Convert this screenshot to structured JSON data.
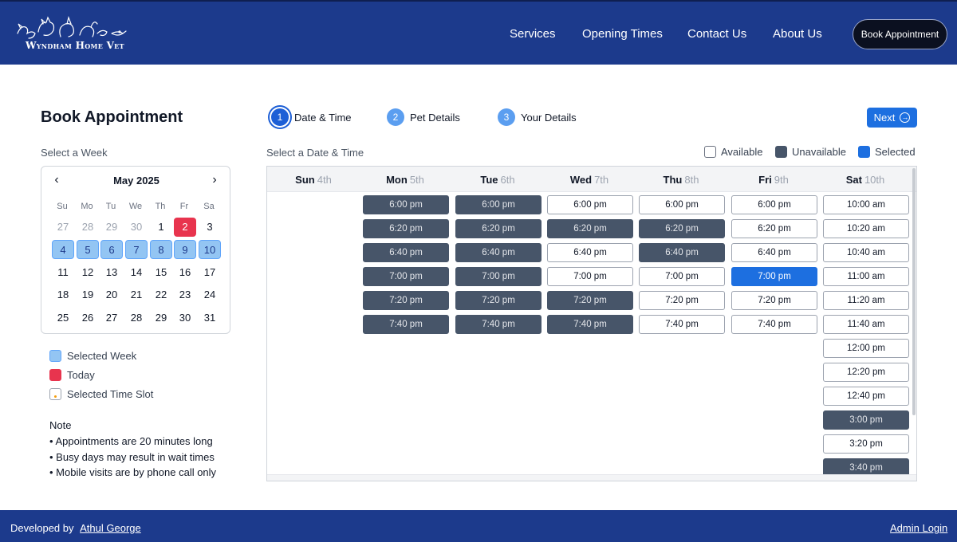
{
  "brand": {
    "name": "Wyndham Home Vet",
    "logo_icon": "pets-line-art-logo"
  },
  "nav": {
    "items": [
      "Services",
      "Opening Times",
      "Contact Us",
      "About Us"
    ],
    "book_label": "Book Appointment"
  },
  "page": {
    "title": "Book Appointment",
    "select_week_label": "Select a Week",
    "select_datetime_label": "Select a Date & Time"
  },
  "calendar": {
    "month": "May 2025",
    "weekdays": [
      "Su",
      "Mo",
      "Tu",
      "We",
      "Th",
      "Fr",
      "Sa"
    ],
    "weeks": [
      [
        "27",
        "28",
        "29",
        "30",
        "1",
        "2",
        "3"
      ],
      [
        "4",
        "5",
        "6",
        "7",
        "8",
        "9",
        "10"
      ],
      [
        "11",
        "12",
        "13",
        "14",
        "15",
        "16",
        "17"
      ],
      [
        "18",
        "19",
        "20",
        "21",
        "22",
        "23",
        "24"
      ],
      [
        "25",
        "26",
        "27",
        "28",
        "29",
        "30",
        "31"
      ]
    ],
    "muted": [
      [
        0,
        0
      ],
      [
        0,
        1
      ],
      [
        0,
        2
      ],
      [
        0,
        3
      ]
    ],
    "today": [
      0,
      5
    ],
    "selected_week_row": 1
  },
  "legend": [
    {
      "label": "Selected Week",
      "color": "#93c5f3",
      "border": "#60a5fa"
    },
    {
      "label": "Today",
      "color": "#e8344e",
      "border": "#e8344e"
    },
    {
      "label": "Selected Time Slot",
      "color": "#ffffff",
      "border": "#9ca3af"
    }
  ],
  "note": {
    "title": "Note",
    "items": [
      "Appointments are 20 minutes long",
      "Busy days may result in wait times",
      "Mobile visits are by phone call only"
    ]
  },
  "steps": [
    {
      "num": "1",
      "label": "Date & Time",
      "active": true
    },
    {
      "num": "2",
      "label": "Pet Details",
      "active": false
    },
    {
      "num": "3",
      "label": "Your Details",
      "active": false
    }
  ],
  "next_label": "Next",
  "key": [
    {
      "label": "Available",
      "color": "#ffffff",
      "border": "#6b7280"
    },
    {
      "label": "Unavailable",
      "color": "#475569",
      "border": "#475569"
    },
    {
      "label": "Selected",
      "color": "#1d6fe0",
      "border": "#1d6fe0"
    }
  ],
  "days": [
    {
      "name": "Sun",
      "num": "4th",
      "slots": []
    },
    {
      "name": "Mon",
      "num": "5th",
      "slots": [
        {
          "t": "6:00 pm",
          "s": "u"
        },
        {
          "t": "6:20 pm",
          "s": "u"
        },
        {
          "t": "6:40 pm",
          "s": "u"
        },
        {
          "t": "7:00 pm",
          "s": "u"
        },
        {
          "t": "7:20 pm",
          "s": "u"
        },
        {
          "t": "7:40 pm",
          "s": "u"
        }
      ]
    },
    {
      "name": "Tue",
      "num": "6th",
      "slots": [
        {
          "t": "6:00 pm",
          "s": "u"
        },
        {
          "t": "6:20 pm",
          "s": "u"
        },
        {
          "t": "6:40 pm",
          "s": "u"
        },
        {
          "t": "7:00 pm",
          "s": "u"
        },
        {
          "t": "7:20 pm",
          "s": "u"
        },
        {
          "t": "7:40 pm",
          "s": "u"
        }
      ]
    },
    {
      "name": "Wed",
      "num": "7th",
      "slots": [
        {
          "t": "6:00 pm",
          "s": "a"
        },
        {
          "t": "6:20 pm",
          "s": "u"
        },
        {
          "t": "6:40 pm",
          "s": "a"
        },
        {
          "t": "7:00 pm",
          "s": "a"
        },
        {
          "t": "7:20 pm",
          "s": "u"
        },
        {
          "t": "7:40 pm",
          "s": "u"
        }
      ]
    },
    {
      "name": "Thu",
      "num": "8th",
      "slots": [
        {
          "t": "6:00 pm",
          "s": "a"
        },
        {
          "t": "6:20 pm",
          "s": "u"
        },
        {
          "t": "6:40 pm",
          "s": "u"
        },
        {
          "t": "7:00 pm",
          "s": "a"
        },
        {
          "t": "7:20 pm",
          "s": "a"
        },
        {
          "t": "7:40 pm",
          "s": "a"
        }
      ]
    },
    {
      "name": "Fri",
      "num": "9th",
      "slots": [
        {
          "t": "6:00 pm",
          "s": "a"
        },
        {
          "t": "6:20 pm",
          "s": "a"
        },
        {
          "t": "6:40 pm",
          "s": "a"
        },
        {
          "t": "7:00 pm",
          "s": "s"
        },
        {
          "t": "7:20 pm",
          "s": "a"
        },
        {
          "t": "7:40 pm",
          "s": "a"
        }
      ]
    },
    {
      "name": "Sat",
      "num": "10th",
      "slots": [
        {
          "t": "10:00 am",
          "s": "a"
        },
        {
          "t": "10:20 am",
          "s": "a"
        },
        {
          "t": "10:40 am",
          "s": "a"
        },
        {
          "t": "11:00 am",
          "s": "a"
        },
        {
          "t": "11:20 am",
          "s": "a"
        },
        {
          "t": "11:40 am",
          "s": "a"
        },
        {
          "t": "12:00 pm",
          "s": "a"
        },
        {
          "t": "12:20 pm",
          "s": "a"
        },
        {
          "t": "12:40 pm",
          "s": "a"
        },
        {
          "t": "3:00 pm",
          "s": "u"
        },
        {
          "t": "3:20 pm",
          "s": "a"
        },
        {
          "t": "3:40 pm",
          "s": "u"
        }
      ]
    }
  ],
  "footer": {
    "developed_by": "Developed by",
    "developer": "Athul George",
    "admin": "Admin Login"
  }
}
